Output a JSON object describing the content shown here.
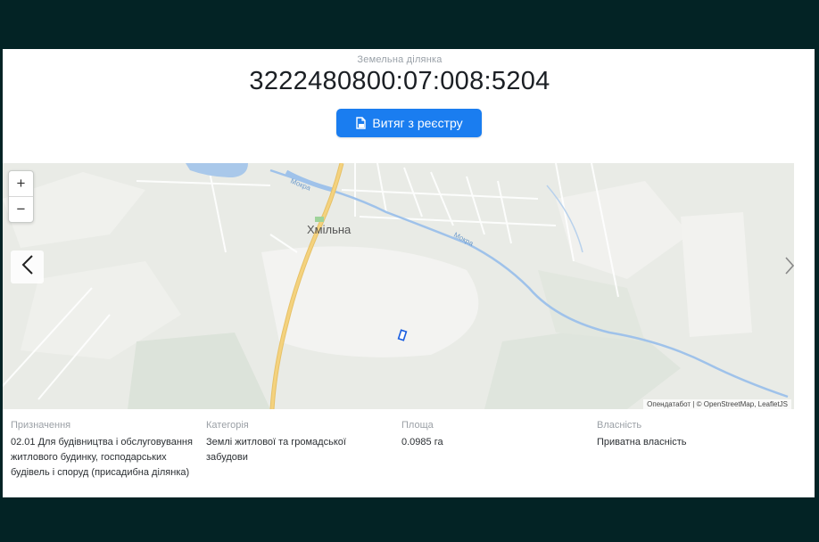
{
  "header": {
    "subtitle": "Земельна ділянка",
    "cadastre_number": "3222480800:07:008:5204",
    "extract_button_label": "Витяг з реєстру"
  },
  "map": {
    "zoom_in": "+",
    "zoom_out": "−",
    "place_label": "Хмільна",
    "river_label_1": "Мокра",
    "river_label_2": "Мокра",
    "attribution": "Опендатабот | © OpenStreetMap, LeafletJS",
    "colors": {
      "water": "#a9c8ea",
      "road": "#f2cf7a",
      "parcel": "#1a5ee0",
      "forest": "#dde3db"
    }
  },
  "details": [
    {
      "label": "Призначення",
      "lines": [
        "02.01 Для будівництва і обслуговування",
        "житлового будинку, господарських",
        "будівель і споруд (присадибна ділянка)"
      ]
    },
    {
      "label": "Категорія",
      "lines": [
        "Землі житлової та громадської",
        "забудови"
      ]
    },
    {
      "label": "Площа",
      "lines": [
        "0.0985 га"
      ]
    },
    {
      "label": "Власність",
      "lines": [
        "Приватна власність"
      ]
    }
  ]
}
